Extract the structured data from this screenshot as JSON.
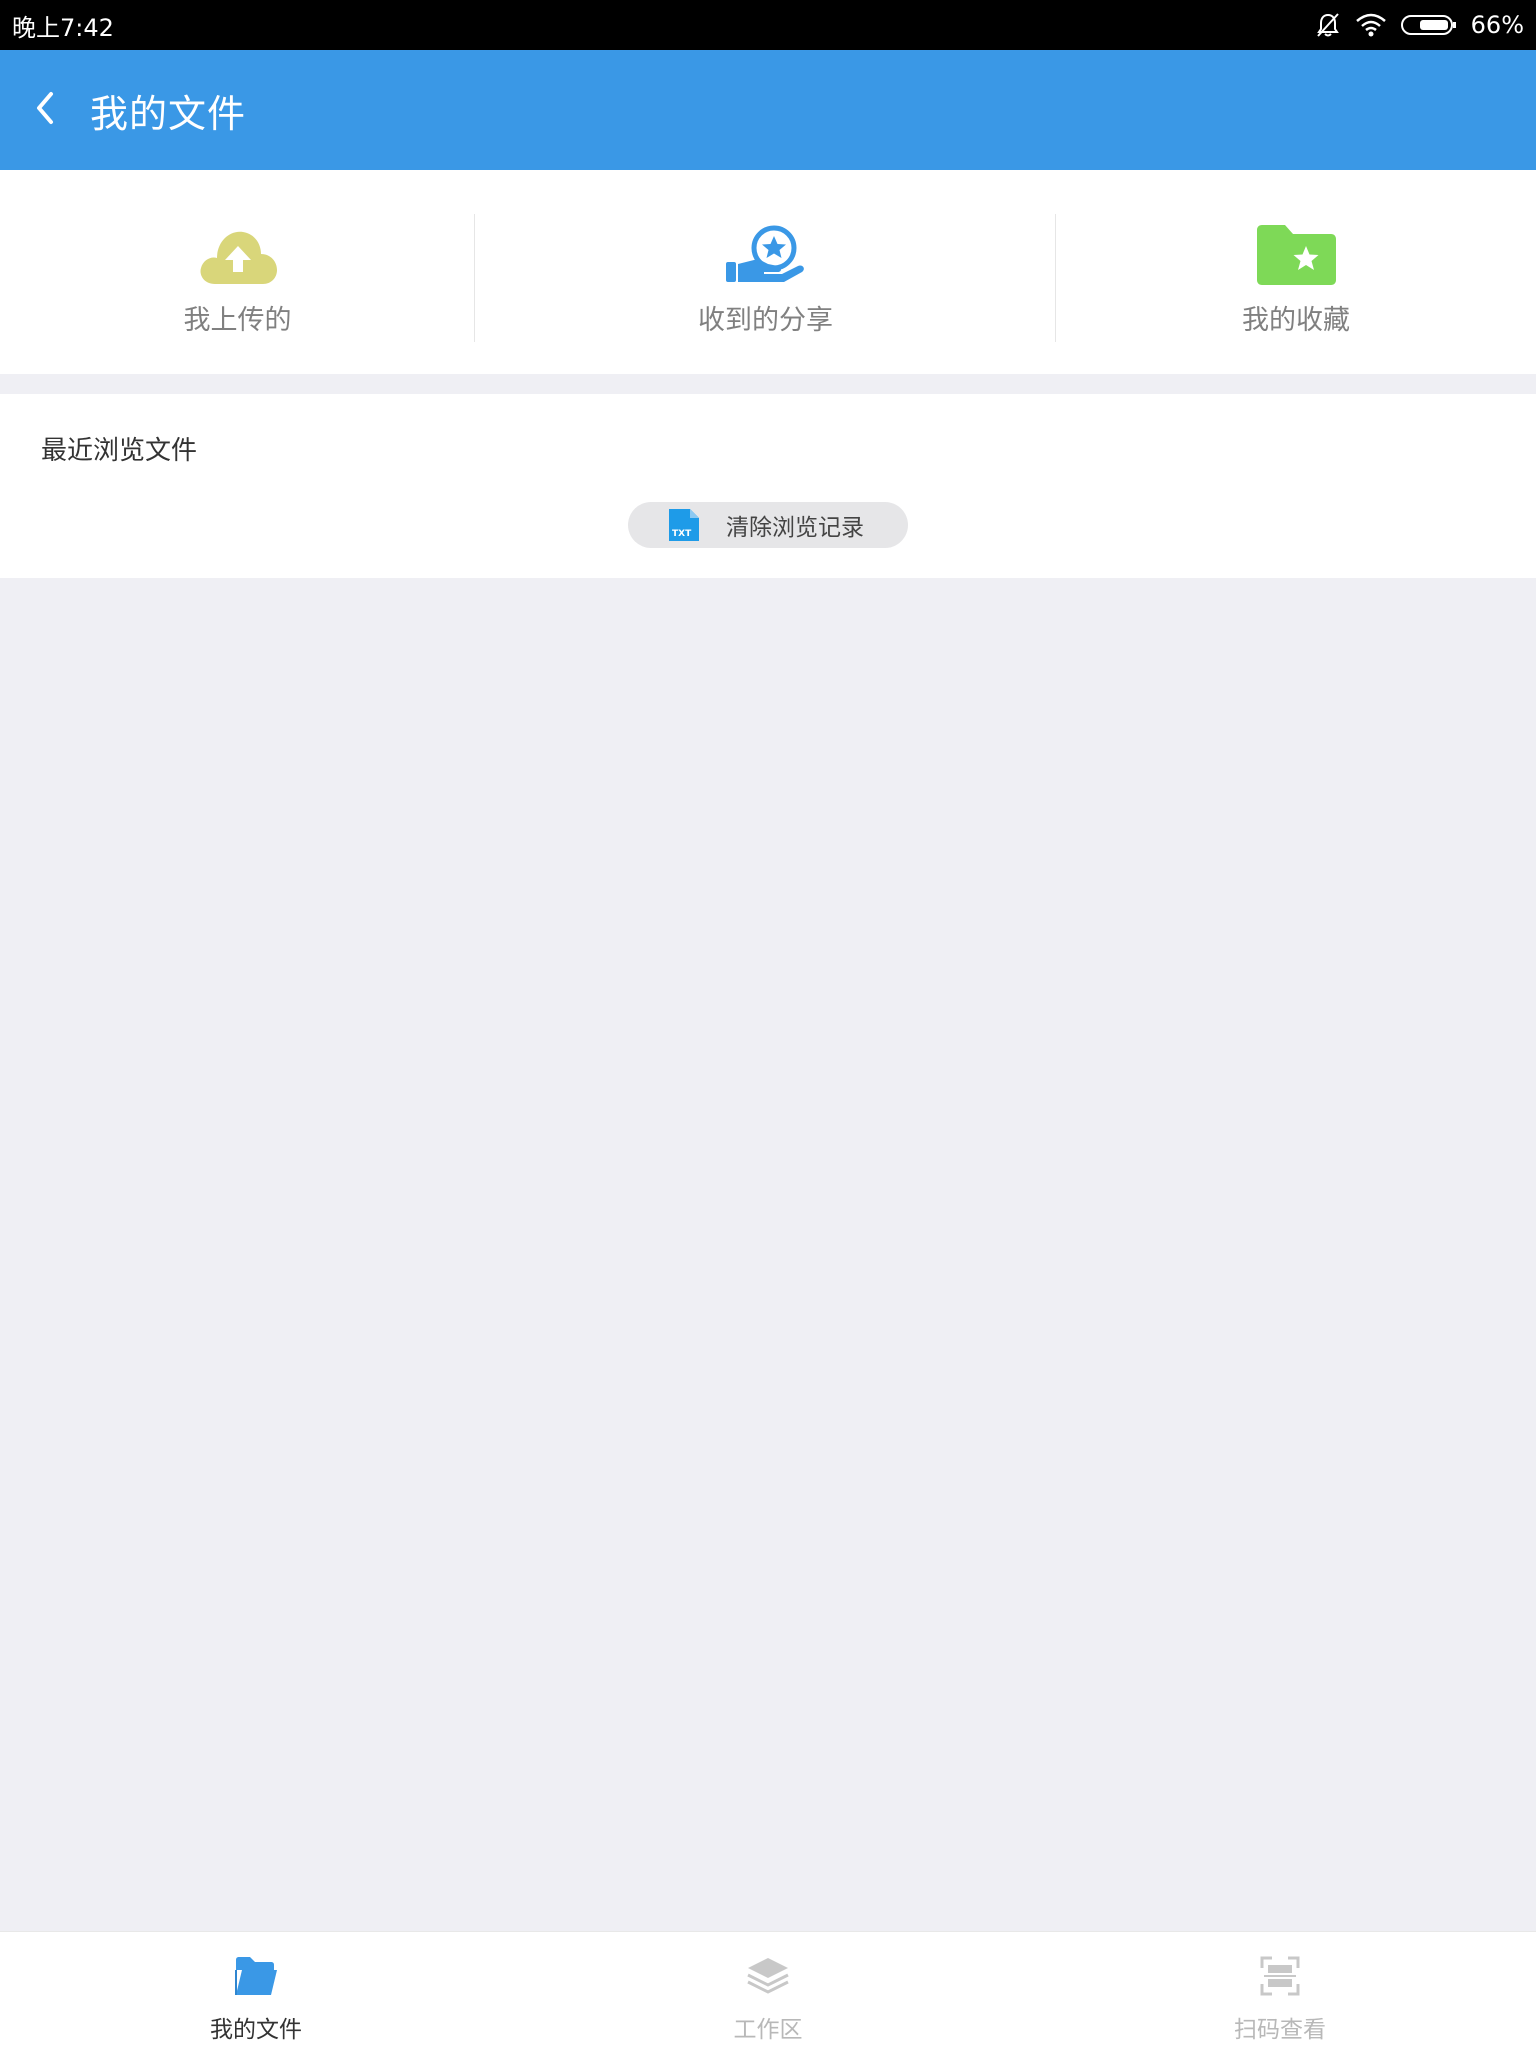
{
  "status_bar": {
    "time": "晚上7:42",
    "battery": "66%"
  },
  "app_bar": {
    "title": "我的文件"
  },
  "quick_actions": [
    {
      "label": "我上传的",
      "icon": "cloud-upload-icon",
      "color": "#d9d67a"
    },
    {
      "label": "收到的分享",
      "icon": "hand-star-icon",
      "color": "#3a98e6"
    },
    {
      "label": "我的收藏",
      "icon": "folder-star-icon",
      "color": "#7ed957"
    }
  ],
  "recent": {
    "title": "最近浏览文件",
    "clear_label": "清除浏览记录",
    "file_badge": "TXT"
  },
  "bottom_nav": {
    "items": [
      {
        "label": "我的文件",
        "icon": "folder-icon",
        "active": true
      },
      {
        "label": "工作区",
        "icon": "layers-icon",
        "active": false
      },
      {
        "label": "扫码查看",
        "icon": "scan-icon",
        "active": false
      }
    ]
  },
  "colors": {
    "primary": "#3a98e6",
    "background": "#efeff4"
  }
}
